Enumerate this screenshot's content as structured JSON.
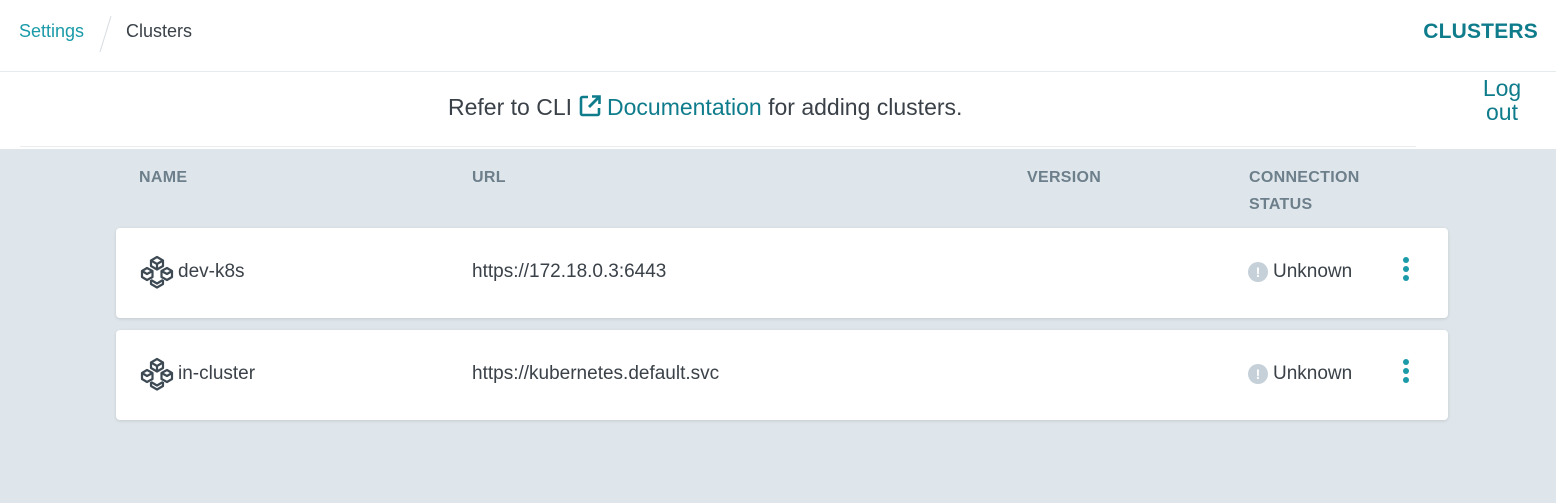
{
  "breadcrumb": {
    "parent": "Settings",
    "current": "Clusters"
  },
  "header": {
    "title": "CLUSTERS"
  },
  "info": {
    "prefix": "Refer to CLI",
    "link_text": "Documentation",
    "suffix": "for adding clusters."
  },
  "logout": {
    "line1": "Log",
    "line2": "out"
  },
  "table": {
    "columns": {
      "name": "NAME",
      "url": "URL",
      "version": "VERSION",
      "status_line1": "CONNECTION",
      "status_line2": "STATUS"
    },
    "rows": [
      {
        "name": "dev-k8s",
        "url": "https://172.18.0.3:6443",
        "version": "",
        "status": "Unknown",
        "status_icon": "!"
      },
      {
        "name": "in-cluster",
        "url": "https://kubernetes.default.svc",
        "version": "",
        "status": "Unknown",
        "status_icon": "!"
      }
    ]
  },
  "colors": {
    "accent": "#0f7c8c",
    "link": "#1b9aa8",
    "background": "#dee6eb",
    "status_unknown": "#c5d0d8"
  }
}
